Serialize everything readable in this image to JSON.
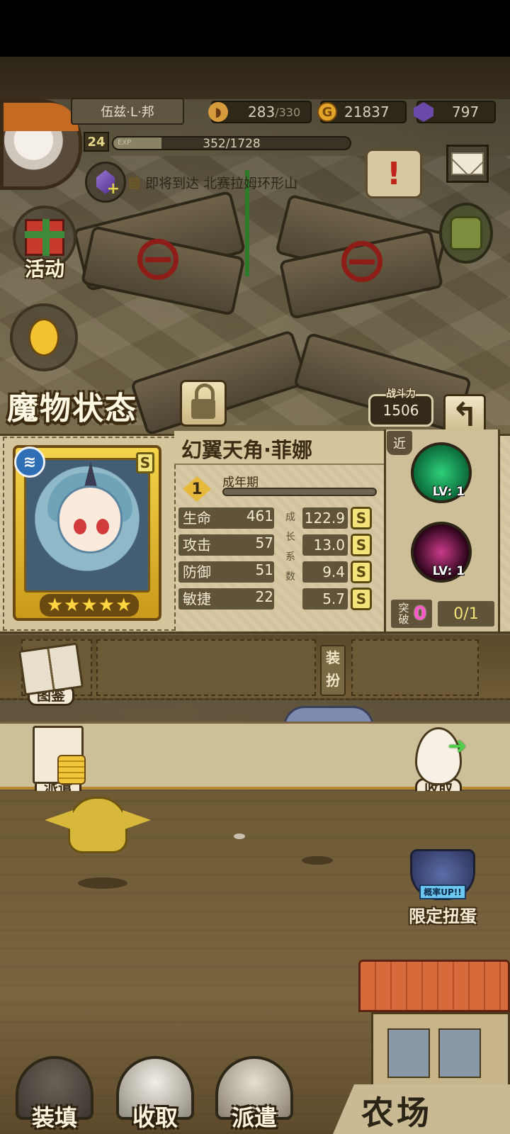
{
  "player": {
    "name": "伍兹·L·邦",
    "level": "24",
    "exp_label": "EXP",
    "exp_text": "352/1728",
    "exp_ratio": 0.2037
  },
  "resources": {
    "food": {
      "icon": "bread-icon",
      "value": "283",
      "max": "/330"
    },
    "gold": {
      "icon": "gold-coin-icon",
      "symbol": "G",
      "value": "21837"
    },
    "gems": {
      "icon": "purple-gem-icon",
      "value": "797"
    }
  },
  "news": {
    "prefix": "兽",
    "text": "即将到达 北赛拉姆环形山"
  },
  "side_buttons": {
    "activity": "活动",
    "egg": "孵蛋"
  },
  "panel": {
    "title": "魔物状态",
    "power_label": "战斗力",
    "power_value": "1506",
    "back_icon": "↰"
  },
  "monster": {
    "name": "幻翼天角·菲娜",
    "element_icon": "water-icon",
    "rank": "S",
    "stars": 5,
    "stage_number": "1",
    "stage_name": "成年期",
    "stage_progress": 0,
    "range": "近",
    "growth_label": [
      "成",
      "长",
      "系",
      "数"
    ],
    "stats": [
      {
        "label": "生命",
        "value": "461",
        "growth": "122.9",
        "grade": "S"
      },
      {
        "label": "攻击",
        "value": "57",
        "growth": "13.0",
        "grade": "S"
      },
      {
        "label": "防御",
        "value": "51",
        "growth": "9.4",
        "grade": "S"
      },
      {
        "label": "敏捷",
        "value": "22",
        "growth": "5.7",
        "grade": "S"
      }
    ],
    "skills": [
      {
        "name": "tree-skill-icon",
        "level": "LV: 1",
        "color": "#0b6b3a"
      },
      {
        "name": "sparkle-skill-icon",
        "level": "LV: 1",
        "color": "#5a0a3a"
      }
    ],
    "breakthrough_label": "突破",
    "breakthrough_count": "0",
    "breakthrough_progress": "0/1"
  },
  "actions": {
    "codex": "图鉴",
    "equip": "装扮",
    "dispatch_small": "派遣",
    "collect_small": "收取",
    "gacha_badge": "概率UP!!",
    "gacha": "限定扭蛋"
  },
  "bottom": {
    "load": "装填",
    "collect": "收取",
    "dispatch": "派遣",
    "farm": "农场"
  },
  "colors": {
    "accent_gold": "#f5d34a",
    "stat_box": "#5f533a",
    "panel_bg": "#d8c9a4",
    "breakthrough_pink": "#ff57c9"
  }
}
